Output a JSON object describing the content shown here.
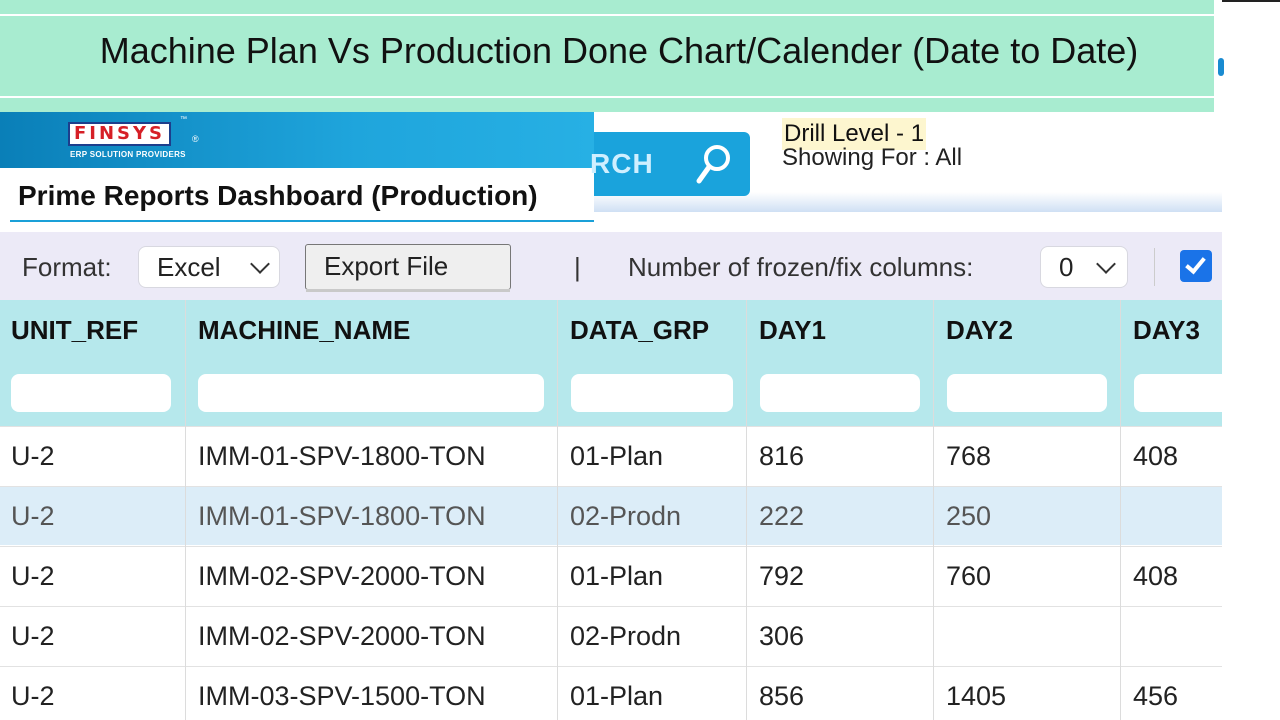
{
  "banner": {
    "title": "Machine Plan Vs Production Done Chart/Calender (Date to Date)"
  },
  "app": {
    "logo_text": "FINSYS",
    "logo_tagline": "ERP SOLUTION PROVIDERS",
    "dashboard_title": "Prime Reports Dashboard (Production)",
    "search_label": "RCH"
  },
  "drill": {
    "level": "Drill Level - 1",
    "showing": "Showing For : All"
  },
  "toolbar": {
    "format_label": "Format:",
    "format_value": "Excel",
    "export_label": "Export File",
    "separator": "|",
    "frozen_label": "Number of frozen/fix columns:",
    "frozen_value": "0",
    "checkbox_checked": true
  },
  "table": {
    "columns": [
      "UNIT_REF",
      "MACHINE_NAME",
      "DATA_GRP",
      "DAY1",
      "DAY2",
      "DAY3"
    ],
    "rows": [
      [
        "U-2",
        "IMM-01-SPV-1800-TON",
        "01-Plan",
        "816",
        "768",
        "408"
      ],
      [
        "U-2",
        "IMM-01-SPV-1800-TON",
        "02-Prodn",
        "222",
        "250",
        ""
      ],
      [
        "U-2",
        "IMM-02-SPV-2000-TON",
        "01-Plan",
        "792",
        "760",
        "408"
      ],
      [
        "U-2",
        "IMM-02-SPV-2000-TON",
        "02-Prodn",
        "306",
        "",
        ""
      ],
      [
        "U-2",
        "IMM-03-SPV-1500-TON",
        "01-Plan",
        "856",
        "1405",
        "456"
      ]
    ]
  },
  "colors": {
    "banner_bg": "#a8ecd0",
    "header_bg": "#b6e8ec",
    "toolbar_bg": "#eceaf7",
    "selected_row_bg": "#dcedf8",
    "accent": "#1aa3dc"
  }
}
